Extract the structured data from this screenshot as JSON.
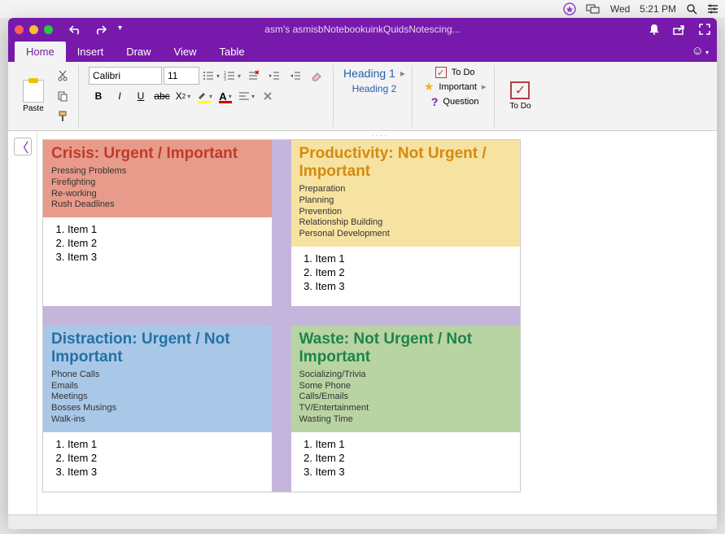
{
  "menubar": {
    "day": "Wed",
    "time": "5:21 PM"
  },
  "window": {
    "title": "asm's asmisbNotebookuinkQuidsNotescing...",
    "tabs": [
      "Home",
      "Insert",
      "Draw",
      "View",
      "Table"
    ],
    "active_tab": "Home"
  },
  "ribbon": {
    "paste": "Paste",
    "font_name": "Calibri",
    "font_size": "11",
    "heading1": "Heading 1",
    "heading2": "Heading 2",
    "tags": {
      "todo": "To Do",
      "important": "Important",
      "question": "Question"
    },
    "todo_btn": "To Do"
  },
  "quadrants": [
    {
      "key": "q1",
      "title": "Crisis: Urgent / Important",
      "subs": [
        "Pressing Problems",
        "Firefighting",
        "Re-working",
        "Rush Deadlines"
      ],
      "items": [
        "Item 1",
        "Item 2",
        "Item 3"
      ]
    },
    {
      "key": "q2",
      "title": "Productivity: Not Urgent / Important",
      "subs": [
        "Preparation",
        "Planning",
        "Prevention",
        "Relationship Building",
        "Personal Development"
      ],
      "items": [
        "Item 1",
        "Item 2",
        "Item 3"
      ]
    },
    {
      "key": "q3",
      "title": "Distraction: Urgent / Not Important",
      "subs": [
        "Phone Calls",
        "Emails",
        "Meetings",
        "Bosses Musings",
        "Walk-ins"
      ],
      "items": [
        "Item 1",
        "Item 2",
        "Item 3"
      ]
    },
    {
      "key": "q4",
      "title": "Waste: Not Urgent / Not Important",
      "subs": [
        "Socializing/Trivia",
        "Some Phone",
        "Calls/Emails",
        "TV/Entertainment",
        "Wasting Time"
      ],
      "items": [
        "Item 1",
        "Item 2",
        "Item 3"
      ]
    }
  ]
}
